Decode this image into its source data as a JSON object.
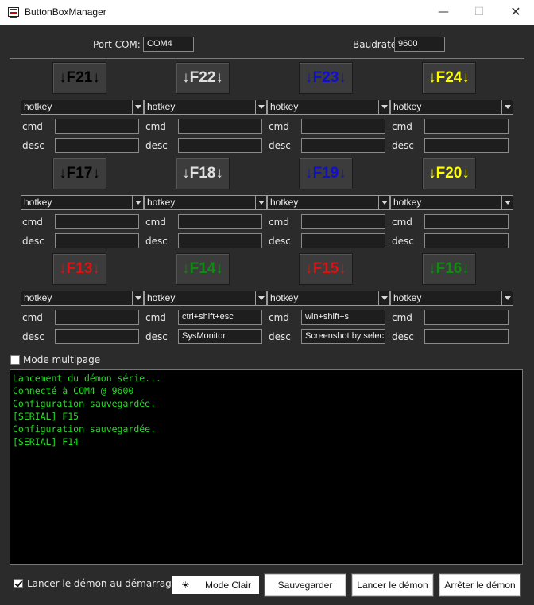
{
  "window": {
    "title": "ButtonBoxManager",
    "controls": {
      "minimize": "—",
      "maximize": "☐",
      "close": "✕"
    }
  },
  "settings": {
    "port_label": "Port COM:",
    "port_value": "COM4",
    "baud_label": "Baudrate:",
    "baud_value": "9600"
  },
  "labels": {
    "cmd": "cmd",
    "desc": "desc"
  },
  "rows": [
    {
      "keys": [
        {
          "label": "↓F21↓",
          "color": "#000000",
          "type": "hotkey",
          "cmd": "",
          "desc": ""
        },
        {
          "label": "↓F22↓",
          "color": "#e0e0e0",
          "type": "hotkey",
          "cmd": "",
          "desc": ""
        },
        {
          "label": "↓F23↓",
          "color": "#1010c8",
          "type": "hotkey",
          "cmd": "",
          "desc": ""
        },
        {
          "label": "↓F24↓",
          "color": "#ffff00",
          "type": "hotkey",
          "cmd": "",
          "desc": ""
        }
      ]
    },
    {
      "keys": [
        {
          "label": "↓F17↓",
          "color": "#000000",
          "type": "hotkey",
          "cmd": "",
          "desc": ""
        },
        {
          "label": "↓F18↓",
          "color": "#e0e0e0",
          "type": "hotkey",
          "cmd": "",
          "desc": ""
        },
        {
          "label": "↓F19↓",
          "color": "#1010c8",
          "type": "hotkey",
          "cmd": "",
          "desc": ""
        },
        {
          "label": "↓F20↓",
          "color": "#ffff00",
          "type": "hotkey",
          "cmd": "",
          "desc": ""
        }
      ]
    },
    {
      "keys": [
        {
          "label": "↓F13↓",
          "color": "#e01010",
          "type": "hotkey",
          "cmd": "",
          "desc": ""
        },
        {
          "label": "↓F14↓",
          "color": "#108a10",
          "type": "hotkey",
          "cmd": "ctrl+shift+esc",
          "desc": "SysMonitor"
        },
        {
          "label": "↓F15↓",
          "color": "#e01010",
          "type": "hotkey",
          "cmd": "win+shift+s",
          "desc": "Screenshot by selec"
        },
        {
          "label": "↓F16↓",
          "color": "#108a10",
          "type": "hotkey",
          "cmd": "",
          "desc": ""
        }
      ]
    }
  ],
  "multipage": {
    "label": "Mode multipage",
    "checked": false
  },
  "console": {
    "lines": [
      "Lancement du démon série...",
      "Connecté à COM4 @ 9600",
      "Configuration sauvegardée.",
      "[SERIAL] F15",
      "Configuration sauvegardée.",
      "[SERIAL] F14"
    ]
  },
  "footer": {
    "autostart_label": "Lancer le démon au démarrage",
    "autostart_checked": true,
    "mode_icon": "sun-icon",
    "mode_label": "Mode Clair",
    "save_label": "Sauvegarder",
    "start_label": "Lancer le démon",
    "stop_label": "Arrêter le démon"
  }
}
